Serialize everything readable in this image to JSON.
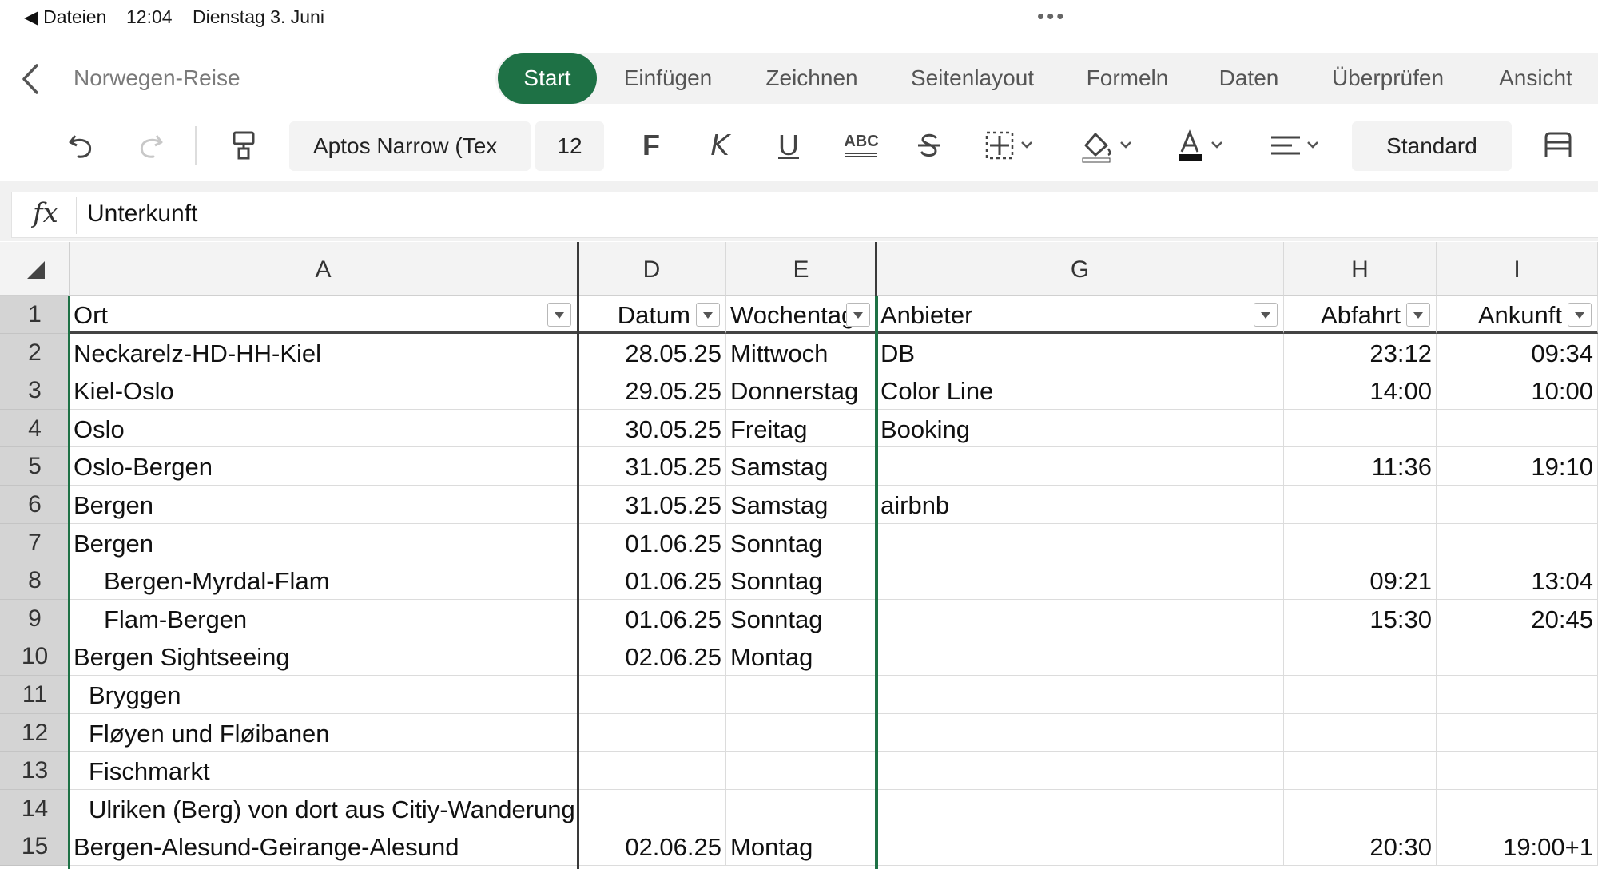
{
  "status_bar": {
    "back_app": "◀ Dateien",
    "time": "12:04",
    "date": "Dienstag 3. Juni",
    "dots": "•••"
  },
  "document": {
    "title": "Norwegen-Reise"
  },
  "tabs": [
    "Start",
    "Einfügen",
    "Zeichnen",
    "Seitenlayout",
    "Formeln",
    "Daten",
    "Überprüfen",
    "Ansicht"
  ],
  "active_tab": "Start",
  "toolbar": {
    "font_name": "Aptos Narrow (Tex",
    "font_size": "12",
    "bold_label": "F",
    "italic_label": "K",
    "underline_label": "U",
    "abc_label": "ABC",
    "number_format": "Standard",
    "icons": [
      "undo-icon",
      "redo-icon",
      "format-painter-icon",
      "strikethrough-icon",
      "borders-icon",
      "fill-color-icon",
      "font-color-icon",
      "align-icon",
      "wrap-icon"
    ]
  },
  "formula_bar": {
    "fx_label": "fx",
    "value": "Unterkunft"
  },
  "grid": {
    "columns": [
      "A",
      "D",
      "E",
      "G",
      "H",
      "I"
    ],
    "rows": [
      {
        "n": "1",
        "A": "Ort",
        "D": "Datum",
        "E": "Wochentag",
        "G": "Anbieter",
        "H": "Abfahrt",
        "I": "Ankunft"
      },
      {
        "n": "2",
        "A": "Neckarelz-HD-HH-Kiel",
        "D": "28.05.25",
        "E": "Mittwoch",
        "G": "DB",
        "H": "23:12",
        "I": "09:34"
      },
      {
        "n": "3",
        "A": "Kiel-Oslo",
        "D": "29.05.25",
        "E": "Donnerstag",
        "G": "Color Line",
        "H": "14:00",
        "I": "10:00"
      },
      {
        "n": "4",
        "A": "Oslo",
        "D": "30.05.25",
        "E": "Freitag",
        "G": "Booking",
        "H": "",
        "I": ""
      },
      {
        "n": "5",
        "A": "Oslo-Bergen",
        "D": "31.05.25",
        "E": "Samstag",
        "G": "",
        "H": "11:36",
        "I": "19:10"
      },
      {
        "n": "6",
        "A": "Bergen",
        "D": "31.05.25",
        "E": "Samstag",
        "G": "airbnb",
        "H": "",
        "I": ""
      },
      {
        "n": "7",
        "A": "Bergen",
        "D": "01.06.25",
        "E": "Sonntag",
        "G": "",
        "H": "",
        "I": ""
      },
      {
        "n": "8",
        "A": "Bergen-Myrdal-Flam",
        "D": "01.06.25",
        "E": "Sonntag",
        "G": "",
        "H": "09:21",
        "I": "13:04"
      },
      {
        "n": "9",
        "A": "Flam-Bergen",
        "D": "01.06.25",
        "E": "Sonntag",
        "G": "",
        "H": "15:30",
        "I": "20:45"
      },
      {
        "n": "10",
        "A": "Bergen Sightseeing",
        "D": "02.06.25",
        "E": "Montag",
        "G": "",
        "H": "",
        "I": ""
      },
      {
        "n": "11",
        "A": "Bryggen",
        "D": "",
        "E": "",
        "G": "",
        "H": "",
        "I": ""
      },
      {
        "n": "12",
        "A": "Fløyen und Fløibanen",
        "D": "",
        "E": "",
        "G": "",
        "H": "",
        "I": ""
      },
      {
        "n": "13",
        "A": "Fischmarkt",
        "D": "",
        "E": "",
        "G": "",
        "H": "",
        "I": ""
      },
      {
        "n": "14",
        "A": "Ulriken (Berg) von dort aus Citiy-Wanderung",
        "D": "",
        "E": "",
        "G": "",
        "H": "",
        "I": ""
      },
      {
        "n": "15",
        "A": "Bergen-Alesund-Geirange-Alesund",
        "D": "02.06.25",
        "E": "Montag",
        "G": "",
        "H": "20:30",
        "I": "19:00+1"
      }
    ],
    "indent_levels": [
      0,
      0,
      0,
      0,
      0,
      0,
      0,
      2,
      2,
      0,
      1,
      1,
      1,
      1,
      0
    ]
  },
  "colors": {
    "accent": "#1e7145",
    "tab_bar_bg": "#f2f2f2",
    "row_header_bg": "#d4d4d4"
  }
}
